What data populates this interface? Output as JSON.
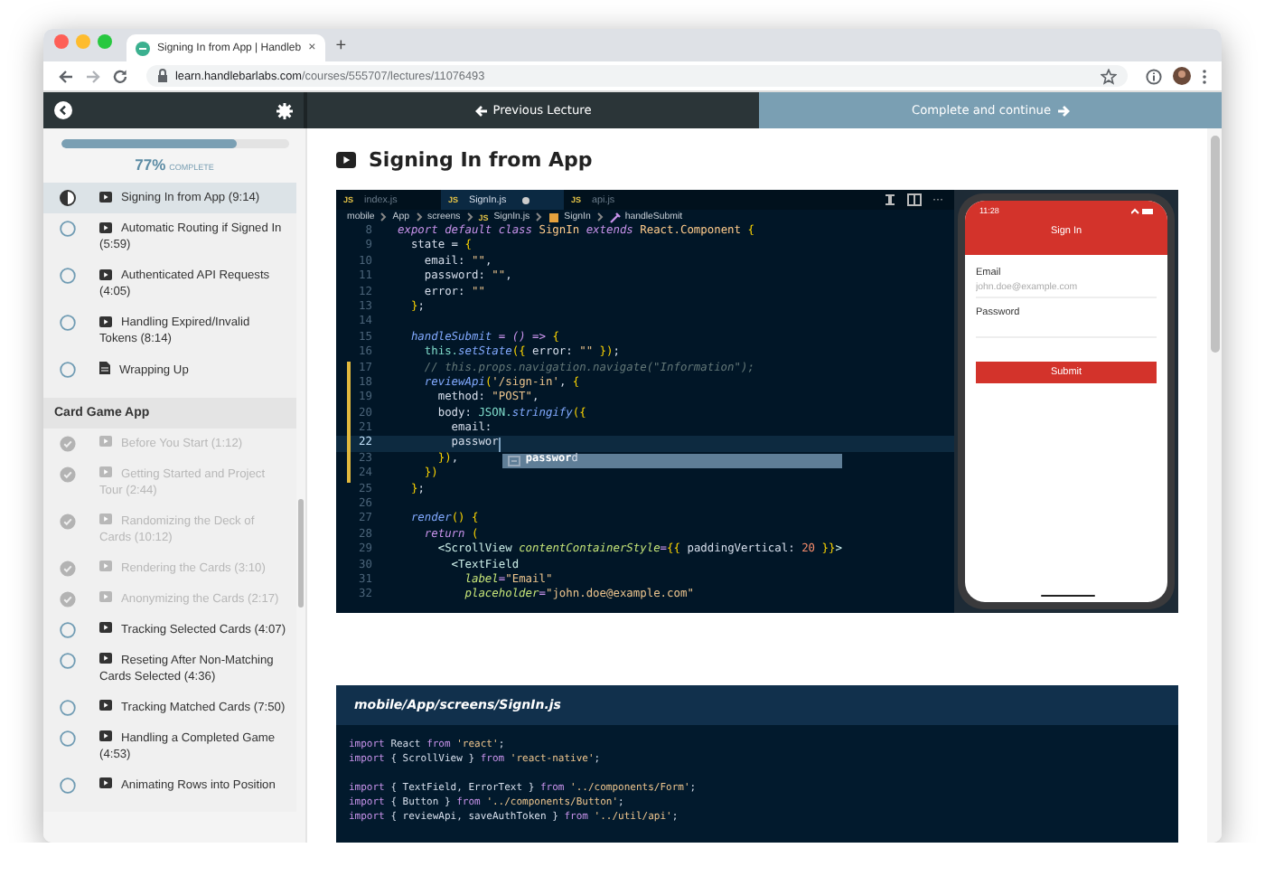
{
  "browser": {
    "tab": {
      "title": "Signing In from App | Handleb",
      "close": "×"
    },
    "new_tab": "+",
    "url": {
      "host": "learn.handlebarlabs.com",
      "path": "/courses/555707/lectures/11076493"
    }
  },
  "top_bar": {
    "previous": "Previous Lecture",
    "next": "Complete and continue"
  },
  "progress": {
    "level": 0.77,
    "percent": "77%",
    "label": "COMPLETE"
  },
  "sections": [
    {
      "items": [
        {
          "title": "Signing In from App (9:14)",
          "current": true,
          "complete": false,
          "kind": "video",
          "selected": true
        },
        {
          "title": "Automatic Routing if Signed In (5:59)",
          "current": false,
          "complete": false,
          "kind": "video",
          "selected": false
        },
        {
          "title": "Authenticated API Requests (4:05)",
          "current": false,
          "complete": false,
          "kind": "video",
          "selected": false
        },
        {
          "title": "Handling Expired/Invalid Tokens (8:14)",
          "current": false,
          "complete": false,
          "kind": "video",
          "selected": false
        },
        {
          "title": "Wrapping Up",
          "current": false,
          "complete": false,
          "kind": "text",
          "selected": false
        }
      ]
    },
    {
      "title": "Card Game App",
      "items": [
        {
          "title": "Before You Start (1:12)",
          "current": false,
          "complete": true,
          "kind": "video",
          "selected": false
        },
        {
          "title": "Getting Started and Project Tour (2:44)",
          "current": false,
          "complete": true,
          "kind": "video",
          "selected": false
        },
        {
          "title": "Randomizing the Deck of Cards (10:12)",
          "current": false,
          "complete": true,
          "kind": "video",
          "selected": false
        },
        {
          "title": "Rendering the Cards (3:10)",
          "current": false,
          "complete": true,
          "kind": "video",
          "selected": false
        },
        {
          "title": "Anonymizing the Cards (2:17)",
          "current": false,
          "complete": true,
          "kind": "video",
          "selected": false
        },
        {
          "title": "Tracking Selected Cards (4:07)",
          "current": false,
          "complete": false,
          "kind": "video",
          "selected": false
        },
        {
          "title": "Reseting After Non-Matching Cards Selected (4:36)",
          "current": false,
          "complete": false,
          "kind": "video",
          "selected": false
        },
        {
          "title": "Tracking Matched Cards (7:50)",
          "current": false,
          "complete": false,
          "kind": "video",
          "selected": false
        },
        {
          "title": "Handling a Completed Game (4:53)",
          "current": false,
          "complete": false,
          "kind": "video",
          "selected": false
        },
        {
          "title": "Animating Rows into Position",
          "current": false,
          "complete": false,
          "kind": "video",
          "selected": false
        }
      ]
    }
  ],
  "lecture": {
    "title": "Signing In from App"
  },
  "editor": {
    "tabs": [
      {
        "badge": "JS",
        "label": "index.js",
        "selected": false,
        "modified": false
      },
      {
        "badge": "JS",
        "label": "SignIn.js",
        "selected": true,
        "modified": true
      },
      {
        "badge": "JS",
        "label": "api.js",
        "selected": false,
        "modified": false
      }
    ],
    "more": "···",
    "breadcrumb": [
      {
        "text": "mobile",
        "kind": "folder"
      },
      {
        "text": "App",
        "kind": "folder"
      },
      {
        "text": "screens",
        "kind": "folder"
      },
      {
        "text": "SignIn.js",
        "kind": "file",
        "badge": "JS"
      },
      {
        "text": "SignIn",
        "kind": "class"
      },
      {
        "text": "handleSubmit",
        "kind": "method"
      }
    ],
    "lines": [
      {
        "n": "8",
        "current": false,
        "changed": false,
        "tokens": [
          {
            "kind": "keyword",
            "text": "export default class "
          },
          {
            "kind": "name",
            "text": "SignIn "
          },
          {
            "kind": "keyword",
            "text": "extends "
          },
          {
            "kind": "name",
            "text": "React.Component "
          },
          {
            "kind": "brace",
            "text": "{"
          }
        ]
      },
      {
        "n": "9",
        "current": false,
        "changed": false,
        "tokens": [
          {
            "kind": "plain",
            "text": "  state = "
          },
          {
            "kind": "brace",
            "text": "{"
          }
        ]
      },
      {
        "n": "10",
        "current": false,
        "changed": false,
        "tokens": [
          {
            "kind": "plain",
            "text": "    email: "
          },
          {
            "kind": "string",
            "text": "\"\""
          },
          {
            "kind": "plain",
            "text": ","
          }
        ]
      },
      {
        "n": "11",
        "current": false,
        "changed": false,
        "tokens": [
          {
            "kind": "plain",
            "text": "    password: "
          },
          {
            "kind": "string",
            "text": "\"\""
          },
          {
            "kind": "plain",
            "text": ","
          }
        ]
      },
      {
        "n": "12",
        "current": false,
        "changed": false,
        "tokens": [
          {
            "kind": "plain",
            "text": "    error: "
          },
          {
            "kind": "string",
            "text": "\"\""
          }
        ]
      },
      {
        "n": "13",
        "current": false,
        "changed": false,
        "tokens": [
          {
            "kind": "brace",
            "text": "  }"
          },
          {
            "kind": "plain",
            "text": ";"
          }
        ]
      },
      {
        "n": "14",
        "current": false,
        "changed": false
      },
      {
        "n": "15",
        "current": false,
        "changed": false,
        "tokens": [
          {
            "kind": "func",
            "text": "  handleSubmit "
          },
          {
            "kind": "keyword",
            "text": "= () => "
          },
          {
            "kind": "brace",
            "text": "{"
          }
        ]
      },
      {
        "n": "16",
        "current": false,
        "changed": false,
        "tokens": [
          {
            "kind": "this",
            "text": "    this."
          },
          {
            "kind": "func",
            "text": "setState"
          },
          {
            "kind": "brace",
            "text": "({ "
          },
          {
            "kind": "plain",
            "text": "error: "
          },
          {
            "kind": "string",
            "text": "\"\" "
          },
          {
            "kind": "brace",
            "text": "})"
          },
          {
            "kind": "plain",
            "text": ";"
          }
        ]
      },
      {
        "n": "17",
        "current": false,
        "changed": true,
        "tokens": [
          {
            "kind": "comment",
            "text": "    // this.props.navigation.navigate(\"Information\");"
          }
        ]
      },
      {
        "n": "18",
        "current": false,
        "changed": true,
        "tokens": [
          {
            "kind": "func",
            "text": "    reviewApi"
          },
          {
            "kind": "brace",
            "text": "("
          },
          {
            "kind": "string",
            "text": "'/sign-in'"
          },
          {
            "kind": "plain",
            "text": ", "
          },
          {
            "kind": "brace",
            "text": "{"
          }
        ]
      },
      {
        "n": "19",
        "current": false,
        "changed": true,
        "tokens": [
          {
            "kind": "plain",
            "text": "      method: "
          },
          {
            "kind": "string",
            "text": "\"POST\""
          },
          {
            "kind": "plain",
            "text": ","
          }
        ]
      },
      {
        "n": "20",
        "current": false,
        "changed": true,
        "tokens": [
          {
            "kind": "plain",
            "text": "      body: "
          },
          {
            "kind": "this",
            "text": "JSON."
          },
          {
            "kind": "func",
            "text": "stringify"
          },
          {
            "kind": "brace",
            "text": "({"
          }
        ]
      },
      {
        "n": "21",
        "current": false,
        "changed": true,
        "tokens": [
          {
            "kind": "plain",
            "text": "        email:"
          }
        ]
      },
      {
        "n": "22",
        "current": true,
        "changed": true,
        "tokens": [
          {
            "kind": "plain",
            "text": "        passwor"
          }
        ]
      },
      {
        "n": "23",
        "current": false,
        "changed": true,
        "tokens": [
          {
            "kind": "brace",
            "text": "      })"
          },
          {
            "kind": "plain",
            "text": ","
          }
        ]
      },
      {
        "n": "24",
        "current": false,
        "changed": true,
        "tokens": [
          {
            "kind": "brace",
            "text": "    })"
          }
        ]
      },
      {
        "n": "25",
        "current": false,
        "changed": false,
        "tokens": [
          {
            "kind": "brace",
            "text": "  }"
          },
          {
            "kind": "plain",
            "text": ";"
          }
        ]
      },
      {
        "n": "26",
        "current": false,
        "changed": false
      },
      {
        "n": "27",
        "current": false,
        "changed": false,
        "tokens": [
          {
            "kind": "func",
            "text": "  render"
          },
          {
            "kind": "brace",
            "text": "() {"
          }
        ]
      },
      {
        "n": "28",
        "current": false,
        "changed": false,
        "tokens": [
          {
            "kind": "keyword",
            "text": "    return "
          },
          {
            "kind": "brace",
            "text": "("
          }
        ]
      },
      {
        "n": "29",
        "current": false,
        "changed": false,
        "tokens": [
          {
            "kind": "tag",
            "text": "      <ScrollView "
          },
          {
            "kind": "attr",
            "text": "contentContainerStyle"
          },
          {
            "kind": "keyword",
            "text": "="
          },
          {
            "kind": "brace",
            "text": "{{ "
          },
          {
            "kind": "plain",
            "text": "paddingVertical: "
          },
          {
            "kind": "number",
            "text": "20 "
          },
          {
            "kind": "brace",
            "text": "}}"
          },
          {
            "kind": "tag",
            "text": ">"
          }
        ]
      },
      {
        "n": "30",
        "current": false,
        "changed": false,
        "tokens": [
          {
            "kind": "tag",
            "text": "        <TextField"
          }
        ]
      },
      {
        "n": "31",
        "current": false,
        "changed": false,
        "tokens": [
          {
            "kind": "attr",
            "text": "          label"
          },
          {
            "kind": "keyword",
            "text": "="
          },
          {
            "kind": "string",
            "text": "\"Email\""
          }
        ]
      },
      {
        "n": "32",
        "current": false,
        "changed": false,
        "tokens": [
          {
            "kind": "attr",
            "text": "          placeholder"
          },
          {
            "kind": "keyword",
            "text": "="
          },
          {
            "kind": "string",
            "text": "\"john.doe@example.com\""
          }
        ]
      }
    ],
    "suggestion": "**passwor**d"
  },
  "phone": {
    "time": "11:28",
    "header": "Sign In",
    "fields": [
      {
        "label": "Email",
        "placeholder": "john.doe@example.com"
      },
      {
        "label": "Password"
      }
    ],
    "button": "Submit"
  },
  "snippet": {
    "filename": "mobile/App/screens/SignIn.js",
    "lines": [
      {
        "kind": "code",
        "tokens": [
          {
            "kind": "import",
            "text": "import "
          },
          {
            "kind": "plain",
            "text": "React "
          },
          {
            "kind": "import",
            "text": "from "
          },
          {
            "kind": "string",
            "text": "'react'"
          },
          {
            "kind": "plain",
            "text": ";"
          }
        ]
      },
      {
        "kind": "code",
        "tokens": [
          {
            "kind": "import",
            "text": "import "
          },
          {
            "kind": "plain",
            "text": "{ ScrollView } "
          },
          {
            "kind": "import",
            "text": "from "
          },
          {
            "kind": "string",
            "text": "'react-native'"
          },
          {
            "kind": "plain",
            "text": ";"
          }
        ]
      },
      {
        "kind": "blank"
      },
      {
        "kind": "code",
        "tokens": [
          {
            "kind": "import",
            "text": "import "
          },
          {
            "kind": "plain",
            "text": "{ TextField, ErrorText } "
          },
          {
            "kind": "import",
            "text": "from "
          },
          {
            "kind": "string",
            "text": "'../components/Form'"
          },
          {
            "kind": "plain",
            "text": ";"
          }
        ]
      },
      {
        "kind": "code",
        "tokens": [
          {
            "kind": "import",
            "text": "import "
          },
          {
            "kind": "plain",
            "text": "{ Button } "
          },
          {
            "kind": "import",
            "text": "from "
          },
          {
            "kind": "string",
            "text": "'../components/Button'"
          },
          {
            "kind": "plain",
            "text": ";"
          }
        ]
      },
      {
        "kind": "code",
        "tokens": [
          {
            "kind": "import",
            "text": "import "
          },
          {
            "kind": "plain",
            "text": "{ reviewApi, saveAuthToken } "
          },
          {
            "kind": "import",
            "text": "from "
          },
          {
            "kind": "string",
            "text": "'../util/api'"
          },
          {
            "kind": "plain",
            "text": ";"
          }
        ]
      }
    ]
  }
}
